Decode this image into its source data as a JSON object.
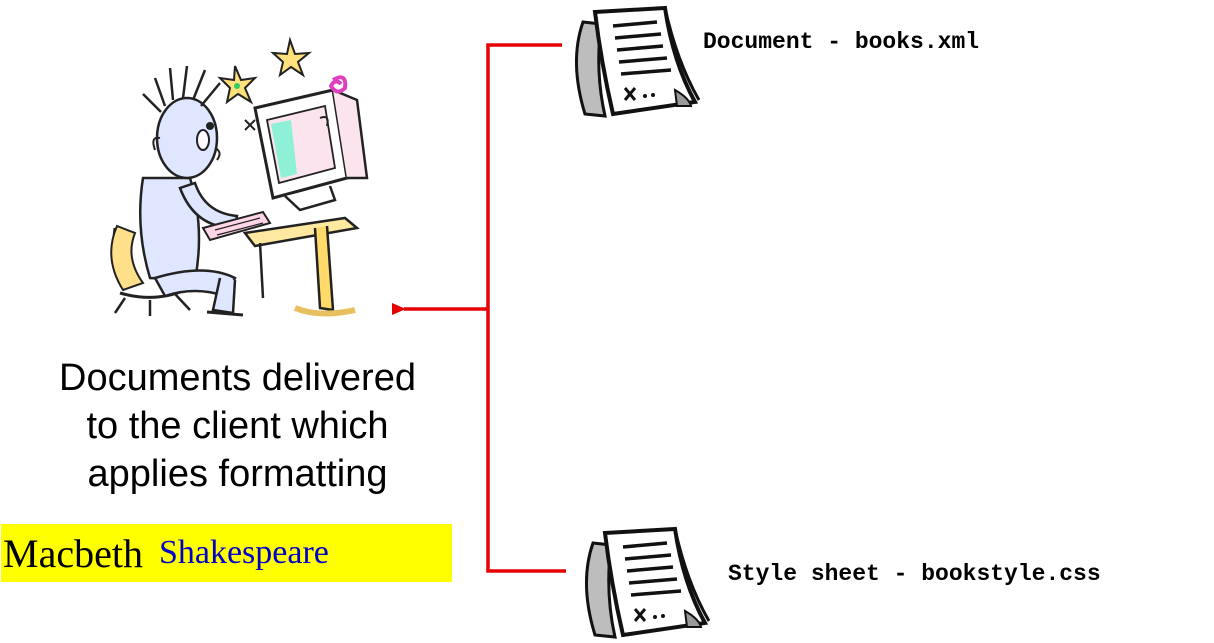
{
  "files": {
    "document_label": "Document - books.xml",
    "stylesheet_label": "Style sheet - bookstyle.css"
  },
  "caption": {
    "line1": "Documents delivered",
    "line2": "to the client which",
    "line3": "applies formatting"
  },
  "rendered_output": {
    "title": "Macbeth",
    "author": "Shakespeare"
  },
  "colors": {
    "connector": "#e60000",
    "highlight": "#ffff00",
    "author_text": "#0000cc"
  },
  "icons": {
    "client": "person-at-computer-clipart",
    "file": "document-scroll-icon"
  }
}
